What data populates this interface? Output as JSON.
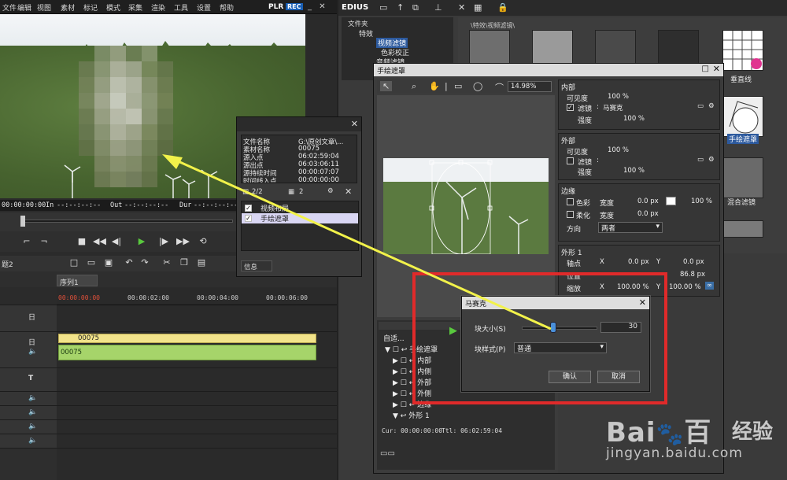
{
  "menubar": {
    "items": [
      "文件",
      "编辑",
      "视图",
      "素材",
      "标记",
      "模式",
      "采集",
      "渲染",
      "工具",
      "设置",
      "帮助"
    ],
    "plr": "PLR",
    "rec": "REC"
  },
  "player": {
    "timecode": "00:00:00:00",
    "in_label": "In",
    "in_value": "--:--:--:--",
    "out_label": "Out",
    "out_value": "--:--:--:--",
    "dur_label": "Dur",
    "dur_value": "--:--:--:--"
  },
  "timeline": {
    "sequence_tab": "序列1",
    "ruler": [
      "00:00:00:00",
      "00:00:02:00",
      "00:00:04:00",
      "00:00:06:00"
    ],
    "clip_video": "00075",
    "clip_audio": "00075",
    "project_label": "题2",
    "track_labels": [
      "日",
      "日",
      "T"
    ]
  },
  "info_popup": {
    "rows": [
      {
        "k": "文件名称",
        "v": "G:\\原创文章\\..."
      },
      {
        "k": "素材名称",
        "v": "00075"
      },
      {
        "k": "源入点",
        "v": "06:02:59:04"
      },
      {
        "k": "源出点",
        "v": "06:03:06:11"
      },
      {
        "k": "源持续时间",
        "v": "00:00:07:07"
      },
      {
        "k": "时间线入点",
        "v": "00:00:00:00"
      }
    ],
    "counter": "2/2",
    "counter2": "2",
    "effects": [
      "视频布局",
      "手绘遮罩"
    ],
    "footer": "信息"
  },
  "edius": {
    "title": "EDIUS",
    "folder_title": "文件夹",
    "tree": [
      "特效",
      "视频滤镜",
      "色彩校正",
      "音频滤镜"
    ],
    "thumb_path": "\\特效\\视频滤镜\\",
    "thumb_labels": [
      "垂直线",
      "手绘遮罩",
      "混合滤镜"
    ]
  },
  "mask_dialog": {
    "title": "手绘遮罩",
    "zoom": "14.98%",
    "inner": {
      "title": "内部",
      "visibility_label": "可见度",
      "visibility_val": "100 %",
      "filter_label": "滤镜",
      "filter_val": "马赛克",
      "strength_label": "强度",
      "strength_val": "100 %"
    },
    "outer": {
      "title": "外部",
      "visibility_label": "可见度",
      "visibility_val": "100 %",
      "filter_label": "滤镜",
      "filter_val": "",
      "strength_label": "强度",
      "strength_val": "100 %"
    },
    "edge": {
      "title": "边缘",
      "color_label": "色彩",
      "width_label": "宽度",
      "width_val": "0.0 px",
      "pct_val": "100 %",
      "soft_label": "柔化",
      "soft_width_label": "宽度",
      "soft_width_val": "0.0 px",
      "dir_label": "方向",
      "dir_val": "两者"
    },
    "shape": {
      "title": "外形 1",
      "axis_label": "轴点",
      "axis_x": "0.0 px",
      "axis_y": "0.0 px",
      "pos_label": "位置",
      "pos_y": "86.8 px",
      "scale_label": "缩放",
      "scale_x": "100.00 %",
      "scale_y": "100.00 %"
    },
    "auto_label": "自适...",
    "layers": [
      "手绘遮罩",
      "内部",
      "内侧",
      "外部",
      "外侧",
      "边缘",
      "外形 1"
    ],
    "cur": "Cur: 00:00:00:00",
    "ttl": "Ttl: 06:02:59:04"
  },
  "mosaic_dialog": {
    "title": "马赛克",
    "block_size_label": "块大小(S)",
    "block_size_value": "30",
    "block_size_fraction": 0.42,
    "block_style_label": "块样式(P)",
    "block_style_value": "普通",
    "ok": "确认",
    "cancel": "取消"
  },
  "watermark": {
    "brand": "Bai",
    "brand2": "百",
    "cn": "经验",
    "url": "jingyan.baidu.com"
  },
  "colors": {
    "clip_video": "#f2e38a",
    "clip_audio": "#a6d46a",
    "highlight": "#e02a2a",
    "arrow": "#f2f24a"
  }
}
